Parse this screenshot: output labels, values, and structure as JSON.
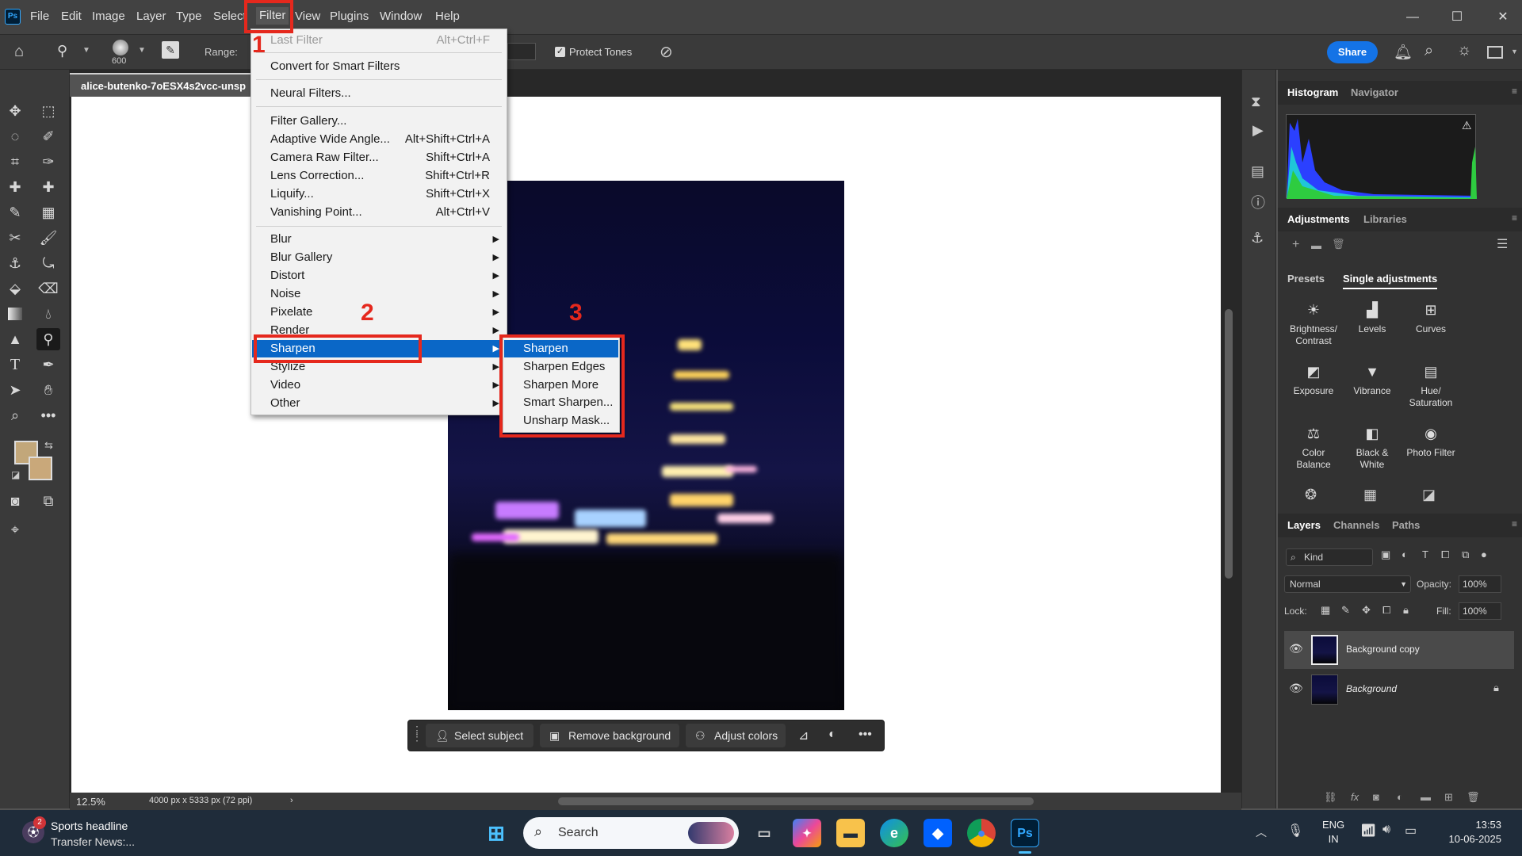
{
  "app": {
    "logo": "Ps"
  },
  "menubar": {
    "items": [
      "File",
      "Edit",
      "Image",
      "Layer",
      "Type",
      "Select",
      "Filter",
      "View",
      "Plugins",
      "Window",
      "Help"
    ],
    "window_controls": {
      "minimize": "—",
      "maximize": "☐",
      "close": "✕"
    }
  },
  "options_bar": {
    "brush_size": "600",
    "range_label": "Range:",
    "protect_tones_label": "Protect Tones",
    "protect_tones_checked": true,
    "share_label": "Share"
  },
  "document": {
    "tab_title": "alice-butenko-7oESX4s2vcc-unsp",
    "zoom": "12.5%",
    "dimensions": "4000 px x 5333 px (72 ppi)"
  },
  "context_bar": {
    "select_subject": "Select subject",
    "remove_background": "Remove background",
    "adjust_colors": "Adjust colors"
  },
  "filter_menu": {
    "items": [
      {
        "label": "Last Filter",
        "shortcut": "Alt+Ctrl+F",
        "disabled": true
      },
      {
        "label": "Convert for Smart Filters",
        "shortcut": ""
      },
      {
        "label": "Neural Filters...",
        "shortcut": ""
      },
      {
        "label": "Filter Gallery...",
        "shortcut": ""
      },
      {
        "label": "Adaptive Wide Angle...",
        "shortcut": "Alt+Shift+Ctrl+A"
      },
      {
        "label": "Camera Raw Filter...",
        "shortcut": "Shift+Ctrl+A"
      },
      {
        "label": "Lens Correction...",
        "shortcut": "Shift+Ctrl+R"
      },
      {
        "label": "Liquify...",
        "shortcut": "Shift+Ctrl+X"
      },
      {
        "label": "Vanishing Point...",
        "shortcut": "Alt+Ctrl+V"
      },
      {
        "label": "Blur",
        "submenu": true
      },
      {
        "label": "Blur Gallery",
        "submenu": true
      },
      {
        "label": "Distort",
        "submenu": true
      },
      {
        "label": "Noise",
        "submenu": true
      },
      {
        "label": "Pixelate",
        "submenu": true
      },
      {
        "label": "Render",
        "submenu": true
      },
      {
        "label": "Sharpen",
        "submenu": true,
        "highlighted": true
      },
      {
        "label": "Stylize",
        "submenu": true
      },
      {
        "label": "Video",
        "submenu": true
      },
      {
        "label": "Other",
        "submenu": true
      }
    ]
  },
  "sharpen_submenu": {
    "items": [
      "Sharpen",
      "Sharpen Edges",
      "Sharpen More",
      "Smart Sharpen...",
      "Unsharp Mask..."
    ]
  },
  "annotations": {
    "step1": "1",
    "step2": "2",
    "step3": "3",
    "color": "#e5281d"
  },
  "right_panel": {
    "histogram_tabs": [
      "Histogram",
      "Navigator"
    ],
    "adjustments_tabs": [
      "Adjustments",
      "Libraries"
    ],
    "adjustment_subtabs": [
      "Presets",
      "Single adjustments"
    ],
    "adjustments": [
      {
        "label1": "Brightness/",
        "label2": "Contrast",
        "icon": "brightness-icon"
      },
      {
        "label1": "Levels",
        "label2": "",
        "icon": "levels-icon"
      },
      {
        "label1": "Curves",
        "label2": "",
        "icon": "curves-icon"
      },
      {
        "label1": "Exposure",
        "label2": "",
        "icon": "exposure-icon"
      },
      {
        "label1": "Vibrance",
        "label2": "",
        "icon": "vibrance-icon"
      },
      {
        "label1": "Hue/",
        "label2": "Saturation",
        "icon": "hue-saturation-icon"
      },
      {
        "label1": "Color",
        "label2": "Balance",
        "icon": "color-balance-icon"
      },
      {
        "label1": "Black &",
        "label2": "White",
        "icon": "black-white-icon"
      },
      {
        "label1": "Photo Filter",
        "label2": "",
        "icon": "photo-filter-icon"
      }
    ],
    "layers_tabs": [
      "Layers",
      "Channels",
      "Paths"
    ],
    "kind_label": "Kind",
    "blend_mode": "Normal",
    "opacity_label": "Opacity:",
    "opacity_value": "100%",
    "lock_label": "Lock:",
    "fill_label": "Fill:",
    "fill_value": "100%",
    "layers": [
      {
        "name": "Background copy",
        "selected": true,
        "locked": false
      },
      {
        "name": "Background",
        "selected": false,
        "locked": true
      }
    ]
  },
  "taskbar": {
    "news_badge": "2",
    "news_title": "Sports headline",
    "news_subtitle": "Transfer News:...",
    "search_placeholder": "Search",
    "language1": "ENG",
    "language2": "IN",
    "time": "13:53",
    "date": "10-06-2025"
  },
  "colors": {
    "accent": "#0a67c7",
    "share": "#1473e6",
    "foreground_swatch": "#c2a77a",
    "background_swatch": "#c9a87a"
  }
}
